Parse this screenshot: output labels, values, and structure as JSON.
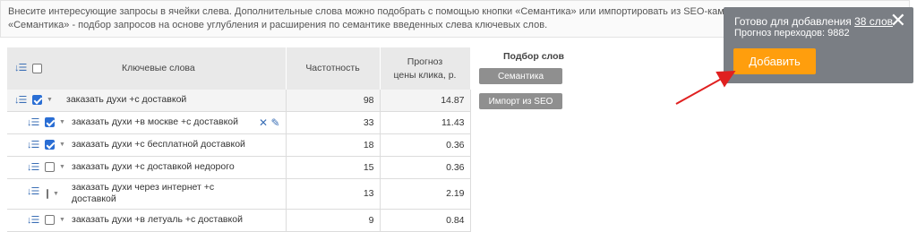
{
  "info": {
    "line1": "Внесите интересующие запросы в ячейки слева. Дополнительные слова можно подобрать с помощью кнопки «Семантика» или импортировать из SEO-кампании проекта.",
    "line2": "«Семантика» - подбор запросов на основе углубления и расширения по семантике введенных слева ключевых слов."
  },
  "table": {
    "col_keywords": "Ключевые слова",
    "col_frequency": "Частотность",
    "col_price_line1": "Прогноз",
    "col_price_line2": "цены клика, р.",
    "rows": [
      {
        "keyword": "заказать духи +с доставкой",
        "frequency": "98",
        "price": "14.87",
        "checked": true,
        "level": 0
      },
      {
        "keyword": "заказать духи +в москве +с доставкой",
        "frequency": "33",
        "price": "11.43",
        "checked": true,
        "level": 1
      },
      {
        "keyword": "заказать духи +с бесплатной доставкой",
        "frequency": "18",
        "price": "0.36",
        "checked": true,
        "level": 1
      },
      {
        "keyword": "заказать духи +с доставкой недорого",
        "frequency": "15",
        "price": "0.36",
        "checked": false,
        "level": 1
      },
      {
        "keyword": "заказать духи через интернет +с доставкой",
        "frequency": "13",
        "price": "2.19",
        "checked": false,
        "level": 1
      },
      {
        "keyword": "заказать духи +в летуаль +с доставкой",
        "frequency": "9",
        "price": "0.84",
        "checked": false,
        "level": 1
      }
    ]
  },
  "side": {
    "title": "Подбор слов",
    "semantics_button": "Семантика",
    "import_button": "Импорт из SEO"
  },
  "popup": {
    "ready_prefix": "Готово для добавления",
    "ready_count": "38 слов",
    "forecast": "Прогноз переходов: 9882",
    "add_button": "Добавить"
  },
  "colors": {
    "accent_orange": "#ff9e0d",
    "popup_bg": "#7a7e84",
    "checkbox_blue": "#2a6ed4",
    "arrow_red": "#e02020"
  }
}
